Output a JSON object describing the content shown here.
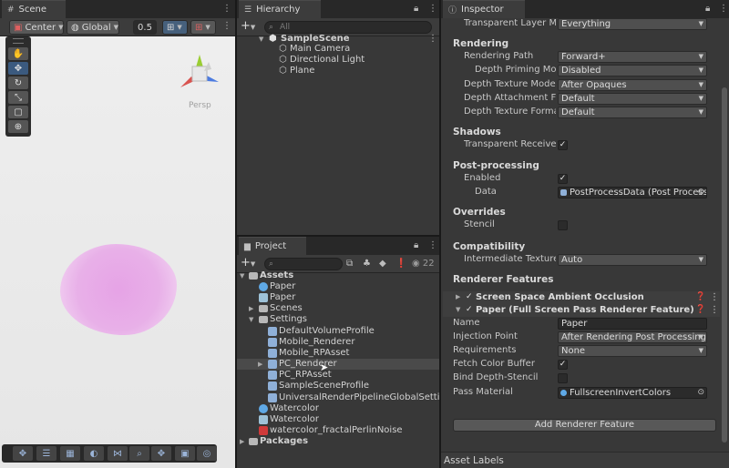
{
  "scene": {
    "tab": "Scene",
    "toolbar": {
      "pivot": "Center",
      "space": "Global",
      "snap": "0.5"
    },
    "gizmo_label": "Persp"
  },
  "hierarchy": {
    "tab": "Hierarchy",
    "search_placeholder": "All",
    "scene_name": "SampleScene",
    "items": [
      "Main Camera",
      "Directional Light",
      "Plane"
    ]
  },
  "project": {
    "tab": "Project",
    "count": "22",
    "assets_label": "Assets",
    "items": [
      {
        "label": "Paper",
        "indent": 1,
        "icon": "material"
      },
      {
        "label": "Paper",
        "indent": 1,
        "icon": "shader"
      },
      {
        "label": "Scenes",
        "indent": 1,
        "icon": "folder",
        "fold": "closed"
      },
      {
        "label": "Settings",
        "indent": 1,
        "icon": "folder",
        "fold": "open"
      },
      {
        "label": "DefaultVolumeProfile",
        "indent": 2,
        "icon": "asset"
      },
      {
        "label": "Mobile_Renderer",
        "indent": 2,
        "icon": "asset"
      },
      {
        "label": "Mobile_RPAsset",
        "indent": 2,
        "icon": "asset"
      },
      {
        "label": "PC_Renderer",
        "indent": 2,
        "icon": "asset",
        "fold": "closed",
        "highlight": true
      },
      {
        "label": "PC_RPAsset",
        "indent": 2,
        "icon": "asset"
      },
      {
        "label": "SampleSceneProfile",
        "indent": 2,
        "icon": "asset"
      },
      {
        "label": "UniversalRenderPipelineGlobalSettings",
        "indent": 2,
        "icon": "asset"
      },
      {
        "label": "Watercolor",
        "indent": 1,
        "icon": "material"
      },
      {
        "label": "Watercolor",
        "indent": 1,
        "icon": "shader"
      },
      {
        "label": "watercolor_fractalPerlinNoise",
        "indent": 1,
        "icon": "texture"
      }
    ],
    "packages_label": "Packages"
  },
  "inspector": {
    "tab": "Inspector",
    "transparent_layer_mask": {
      "label": "Transparent Layer Mask",
      "value": "Everything"
    },
    "rendering": {
      "title": "Rendering",
      "rendering_path": {
        "label": "Rendering Path",
        "value": "Forward+"
      },
      "depth_priming": {
        "label": "Depth Priming Mode",
        "value": "Disabled"
      },
      "depth_texture_mode": {
        "label": "Depth Texture Mode",
        "value": "After Opaques"
      },
      "depth_attachment": {
        "label": "Depth Attachment Format",
        "value": "Default"
      },
      "depth_texture_format": {
        "label": "Depth Texture Format",
        "value": "Default"
      }
    },
    "shadows": {
      "title": "Shadows",
      "transparent_receive": {
        "label": "Transparent Receive Shadows",
        "checked": "✓"
      }
    },
    "post_processing": {
      "title": "Post-processing",
      "enabled": {
        "label": "Enabled",
        "checked": "✓"
      },
      "data": {
        "label": "Data",
        "value": "PostProcessData (Post Process Data)"
      }
    },
    "overrides": {
      "title": "Overrides",
      "stencil": {
        "label": "Stencil"
      }
    },
    "compatibility": {
      "title": "Compatibility",
      "intermediate_texture": {
        "label": "Intermediate Texture",
        "value": "Auto"
      }
    },
    "renderer_features": {
      "title": "Renderer Features",
      "ssao": {
        "title": "Screen Space Ambient Occlusion"
      },
      "paper": {
        "title": "Paper (Full Screen Pass Renderer Feature)",
        "name": {
          "label": "Name",
          "value": "Paper"
        },
        "injection_point": {
          "label": "Injection Point",
          "value": "After Rendering Post Processing"
        },
        "requirements": {
          "label": "Requirements",
          "value": "None"
        },
        "fetch_color_buffer": {
          "label": "Fetch Color Buffer",
          "checked": "✓"
        },
        "bind_depth_stencil": {
          "label": "Bind Depth-Stencil"
        },
        "pass_material": {
          "label": "Pass Material",
          "value": "FullscreenInvertColors"
        }
      },
      "add_button": "Add Renderer Feature"
    },
    "asset_labels": "Asset Labels"
  }
}
